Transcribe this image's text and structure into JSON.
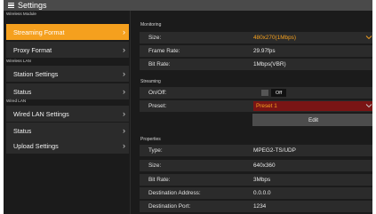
{
  "window": {
    "title": "Settings"
  },
  "sidebar": {
    "groups": [
      {
        "label": "Wireless Module"
      },
      {
        "label": "Wireless LAN"
      },
      {
        "label": "Wired LAN"
      }
    ],
    "items": [
      {
        "label": "Streaming Format",
        "active": true
      },
      {
        "label": "Proxy Format"
      },
      {
        "label": "Station Settings"
      },
      {
        "label": "Status"
      },
      {
        "label": "Wired LAN Settings"
      },
      {
        "label": "Status"
      },
      {
        "label": "Upload Settings"
      }
    ]
  },
  "monitoring": {
    "section_label": "Monitoring",
    "size_label": "Size:",
    "size_value": "480x270(1Mbps)",
    "frame_rate_label": "Frame Rate:",
    "frame_rate_value": "29.97fps",
    "bit_rate_label": "Bit Rate:",
    "bit_rate_value": "1Mbps(VBR)"
  },
  "streaming": {
    "section_label": "Streaming",
    "onoff_label": "On/Off:",
    "onoff_value": "Off",
    "preset_label": "Preset:",
    "preset_value": "Preset 1",
    "edit_label": "Edit"
  },
  "properties": {
    "section_label": "Properties",
    "type_label": "Type:",
    "type_value": "MPEG2-TS/UDP",
    "size_label": "Size:",
    "size_value": "640x360",
    "bit_rate_label": "Bit Rate:",
    "bit_rate_value": "3Mbps",
    "dest_address_label": "Destination Address:",
    "dest_address_value": "0.0.0.0",
    "dest_port_label": "Destination Port:",
    "dest_port_value": "1234"
  },
  "colors": {
    "accent": "#f5a01e",
    "background": "#1b1b1b",
    "row": "#2b2b2b",
    "preset_highlight": "#7a1515"
  },
  "icons": {
    "menu": "hamburger-icon",
    "chevron_right": "chevron-right-icon",
    "chevron_down": "chevron-down-icon"
  }
}
